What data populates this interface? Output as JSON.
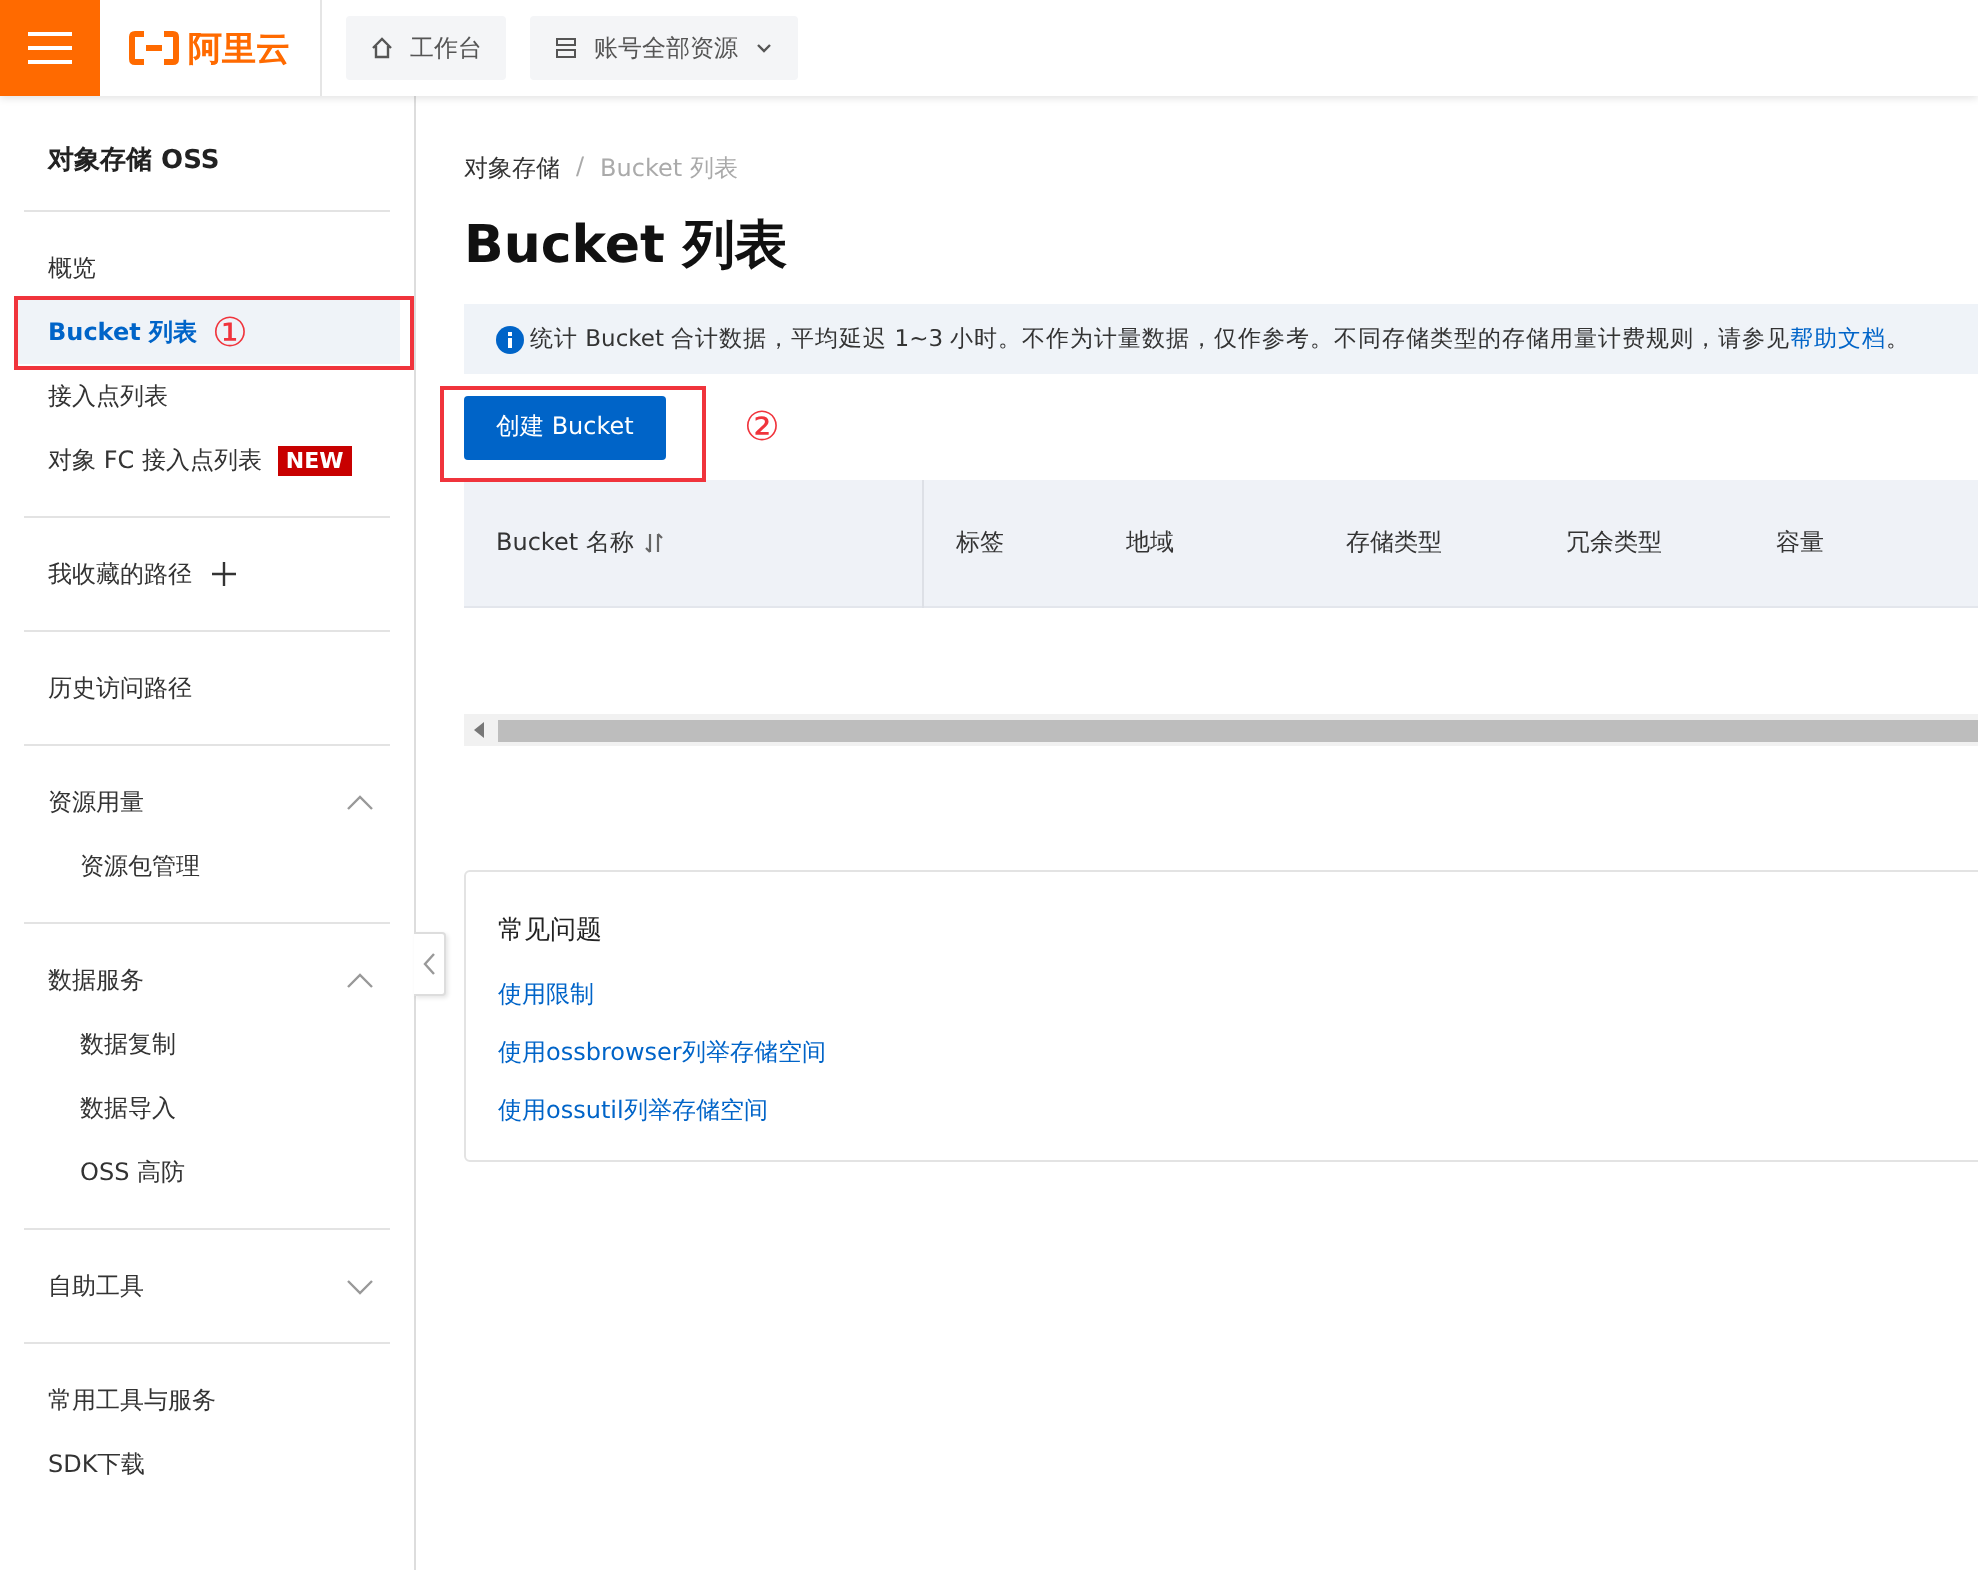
{
  "topbar": {
    "logo": "阿里云",
    "buttons": [
      {
        "label": "工作台",
        "kind": "home"
      },
      {
        "label": "账号全部资源",
        "kind": "dropdown"
      }
    ]
  },
  "sidebar": {
    "title": "对象存储 OSS",
    "sections": [
      {
        "items": [
          {
            "label": "概览",
            "kind": "item",
            "selected": false
          },
          {
            "label": "Bucket 列表",
            "kind": "item",
            "selected": true,
            "annotation": "①"
          },
          {
            "label": "接入点列表",
            "kind": "item",
            "selected": false
          },
          {
            "label": "对象 FC 接入点列表",
            "kind": "item",
            "selected": false,
            "badge": "NEW"
          }
        ]
      },
      {
        "items": [
          {
            "label": "我收藏的路径",
            "kind": "add",
            "selected": false
          }
        ]
      },
      {
        "items": [
          {
            "label": "历史访问路径",
            "kind": "item",
            "selected": false
          }
        ]
      },
      {
        "items": [
          {
            "label": "资源用量",
            "kind": "group",
            "selected": false,
            "expanded": true,
            "children": [
              {
                "label": "资源包管理",
                "selected": false
              }
            ]
          }
        ]
      },
      {
        "items": [
          {
            "label": "数据服务",
            "kind": "group",
            "selected": false,
            "expanded": true,
            "children": [
              {
                "label": "数据复制",
                "selected": false
              },
              {
                "label": "数据导入",
                "selected": false
              },
              {
                "label": "OSS 高防",
                "selected": false
              }
            ]
          }
        ]
      },
      {
        "items": [
          {
            "label": "自助工具",
            "kind": "group",
            "selected": false,
            "expanded": false
          }
        ]
      },
      {
        "items": [
          {
            "label": "常用工具与服务",
            "kind": "item",
            "selected": false
          },
          {
            "label": "SDK下载",
            "kind": "item",
            "selected": false
          }
        ]
      }
    ]
  },
  "breadcrumb": [
    "对象存储",
    "Bucket 列表"
  ],
  "breadcrumb_separator": "/",
  "page_title": "Bucket 列表",
  "notice": {
    "text": "统计 Bucket 合计数据，平均延迟 1~3 小时。不作为计量数据，仅作参考。不同存储类型的存储用量计费规则，请参见",
    "link": "帮助文档",
    "end": "。"
  },
  "create_button": {
    "label": "创建 Bucket",
    "annotation": "②"
  },
  "table": {
    "columns": [
      {
        "label": "Bucket 名称",
        "sortable": true
      },
      {
        "label": "标签",
        "sortable": false
      },
      {
        "label": "地域",
        "sortable": false
      },
      {
        "label": "存储类型",
        "sortable": false
      },
      {
        "label": "冗余类型",
        "sortable": false
      },
      {
        "label": "容量",
        "sortable": false
      }
    ]
  },
  "faq": {
    "title": "常见问题",
    "links": [
      "使用限制",
      "使用ossbrowser列举存储空间",
      "使用ossutil列举存储空间"
    ]
  }
}
